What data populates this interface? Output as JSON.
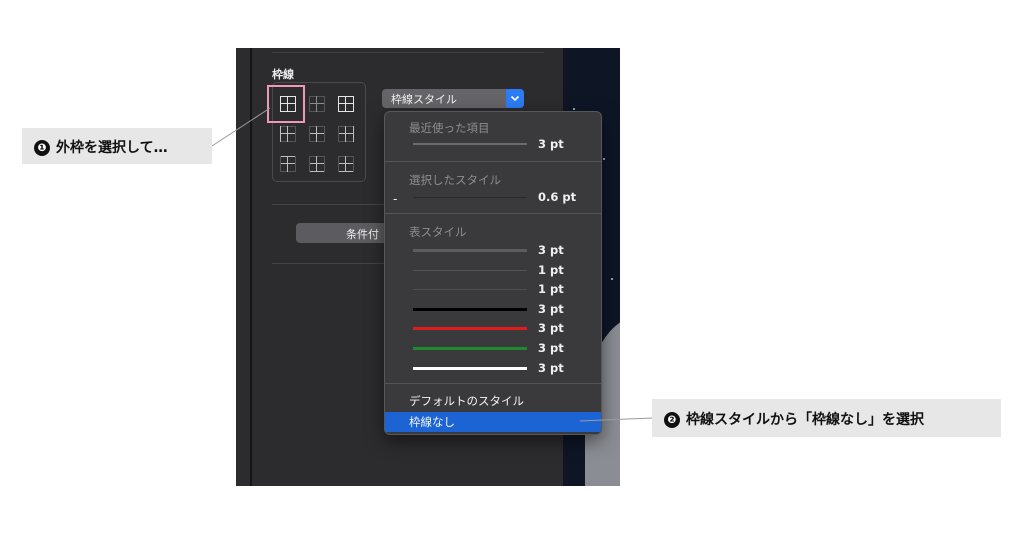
{
  "borders": {
    "section_label": "枠線",
    "style_select_label": "枠線スタイル",
    "conditional_button_label": "条件付"
  },
  "menu": {
    "recent": {
      "header": "最近使った項目",
      "items": [
        {
          "value": "3 pt",
          "color": "#6a6a6d",
          "weight": 2
        }
      ]
    },
    "selected": {
      "header": "選択したスタイル",
      "dash": "-",
      "items": [
        {
          "value": "0.6 pt",
          "color": "#2a2a2c",
          "weight": 1
        }
      ]
    },
    "table_styles": {
      "header": "表スタイル",
      "items": [
        {
          "value": "3 pt",
          "color": "#5d5d60",
          "weight": 3
        },
        {
          "value": "1 pt",
          "color": "#535356",
          "weight": 1
        },
        {
          "value": "1 pt",
          "color": "#4e4e51",
          "weight": 1
        },
        {
          "value": "3 pt",
          "color": "#000000",
          "weight": 3
        },
        {
          "value": "3 pt",
          "color": "#e01b1b",
          "weight": 3
        },
        {
          "value": "3 pt",
          "color": "#1f8a2c",
          "weight": 3
        },
        {
          "value": "3 pt",
          "color": "#ffffff",
          "weight": 3
        }
      ]
    },
    "default_style": "デフォルトのスタイル",
    "no_border": "枠線なし",
    "highlight_color": "#1c64d4"
  },
  "callouts": [
    {
      "number": "❶",
      "text": "外枠を選択して…"
    },
    {
      "number": "❷",
      "text": "枠線スタイルから「枠線なし」を選択"
    }
  ],
  "colors": {
    "panel_bg": "#2c2c2e",
    "accent_blue": "#2d7cf6",
    "selection_pink": "#ef9ab5"
  }
}
